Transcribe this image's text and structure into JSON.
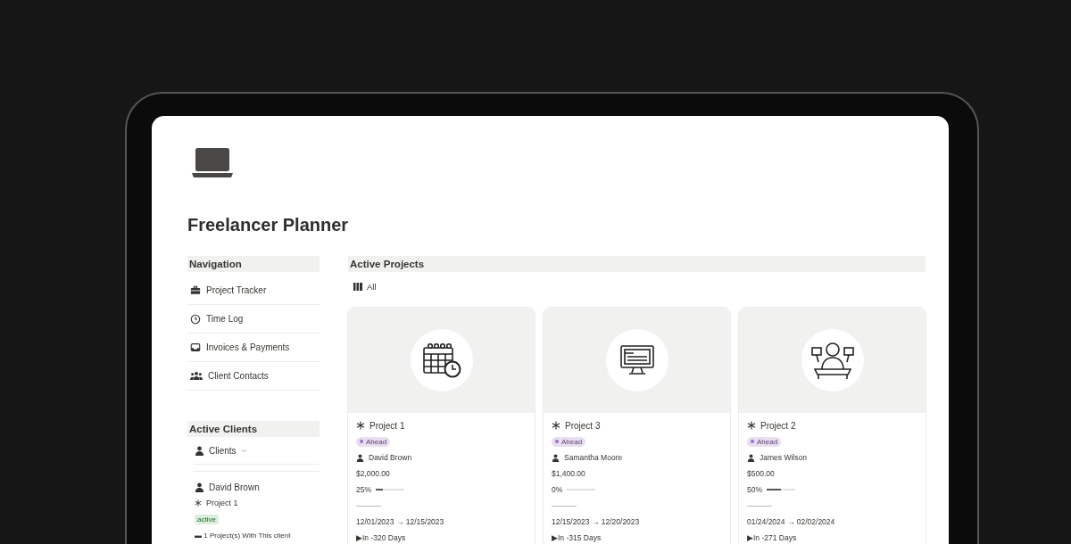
{
  "page": {
    "title": "Freelancer Planner"
  },
  "navigation": {
    "heading": "Navigation",
    "items": [
      {
        "label": "Project Tracker"
      },
      {
        "label": "Time Log"
      },
      {
        "label": "Invoices & Payments"
      },
      {
        "label": "Client Contacts"
      }
    ]
  },
  "active_clients": {
    "heading": "Active Clients",
    "view": "Clients",
    "clients": [
      {
        "name": "David Brown",
        "project": "Project 1",
        "status": "active",
        "summary": "▬ 1 Project(s) With This client"
      }
    ]
  },
  "active_projects": {
    "heading": "Active Projects",
    "view": "All",
    "cards": [
      {
        "name": "Project 1",
        "status": "Ahead",
        "client": "David Brown",
        "budget": "$2,000.00",
        "progress": "25%",
        "level": 0.25,
        "dates": "12/01/2023 → 12/15/2023",
        "due": "▶In -320 Days"
      },
      {
        "name": "Project 3",
        "status": "Ahead",
        "client": "Samantha Moore",
        "budget": "$1,400.00",
        "progress": "0%",
        "level": 0,
        "dates": "12/15/2023 → 12/20/2023",
        "due": "▶In -315 Days"
      },
      {
        "name": "Project 2",
        "status": "Ahead",
        "client": "James Wilson",
        "budget": "$500.00",
        "progress": "50%",
        "level": 0.5,
        "dates": "01/24/2024 → 02/02/2024",
        "due": "▶In -271 Days"
      }
    ]
  }
}
